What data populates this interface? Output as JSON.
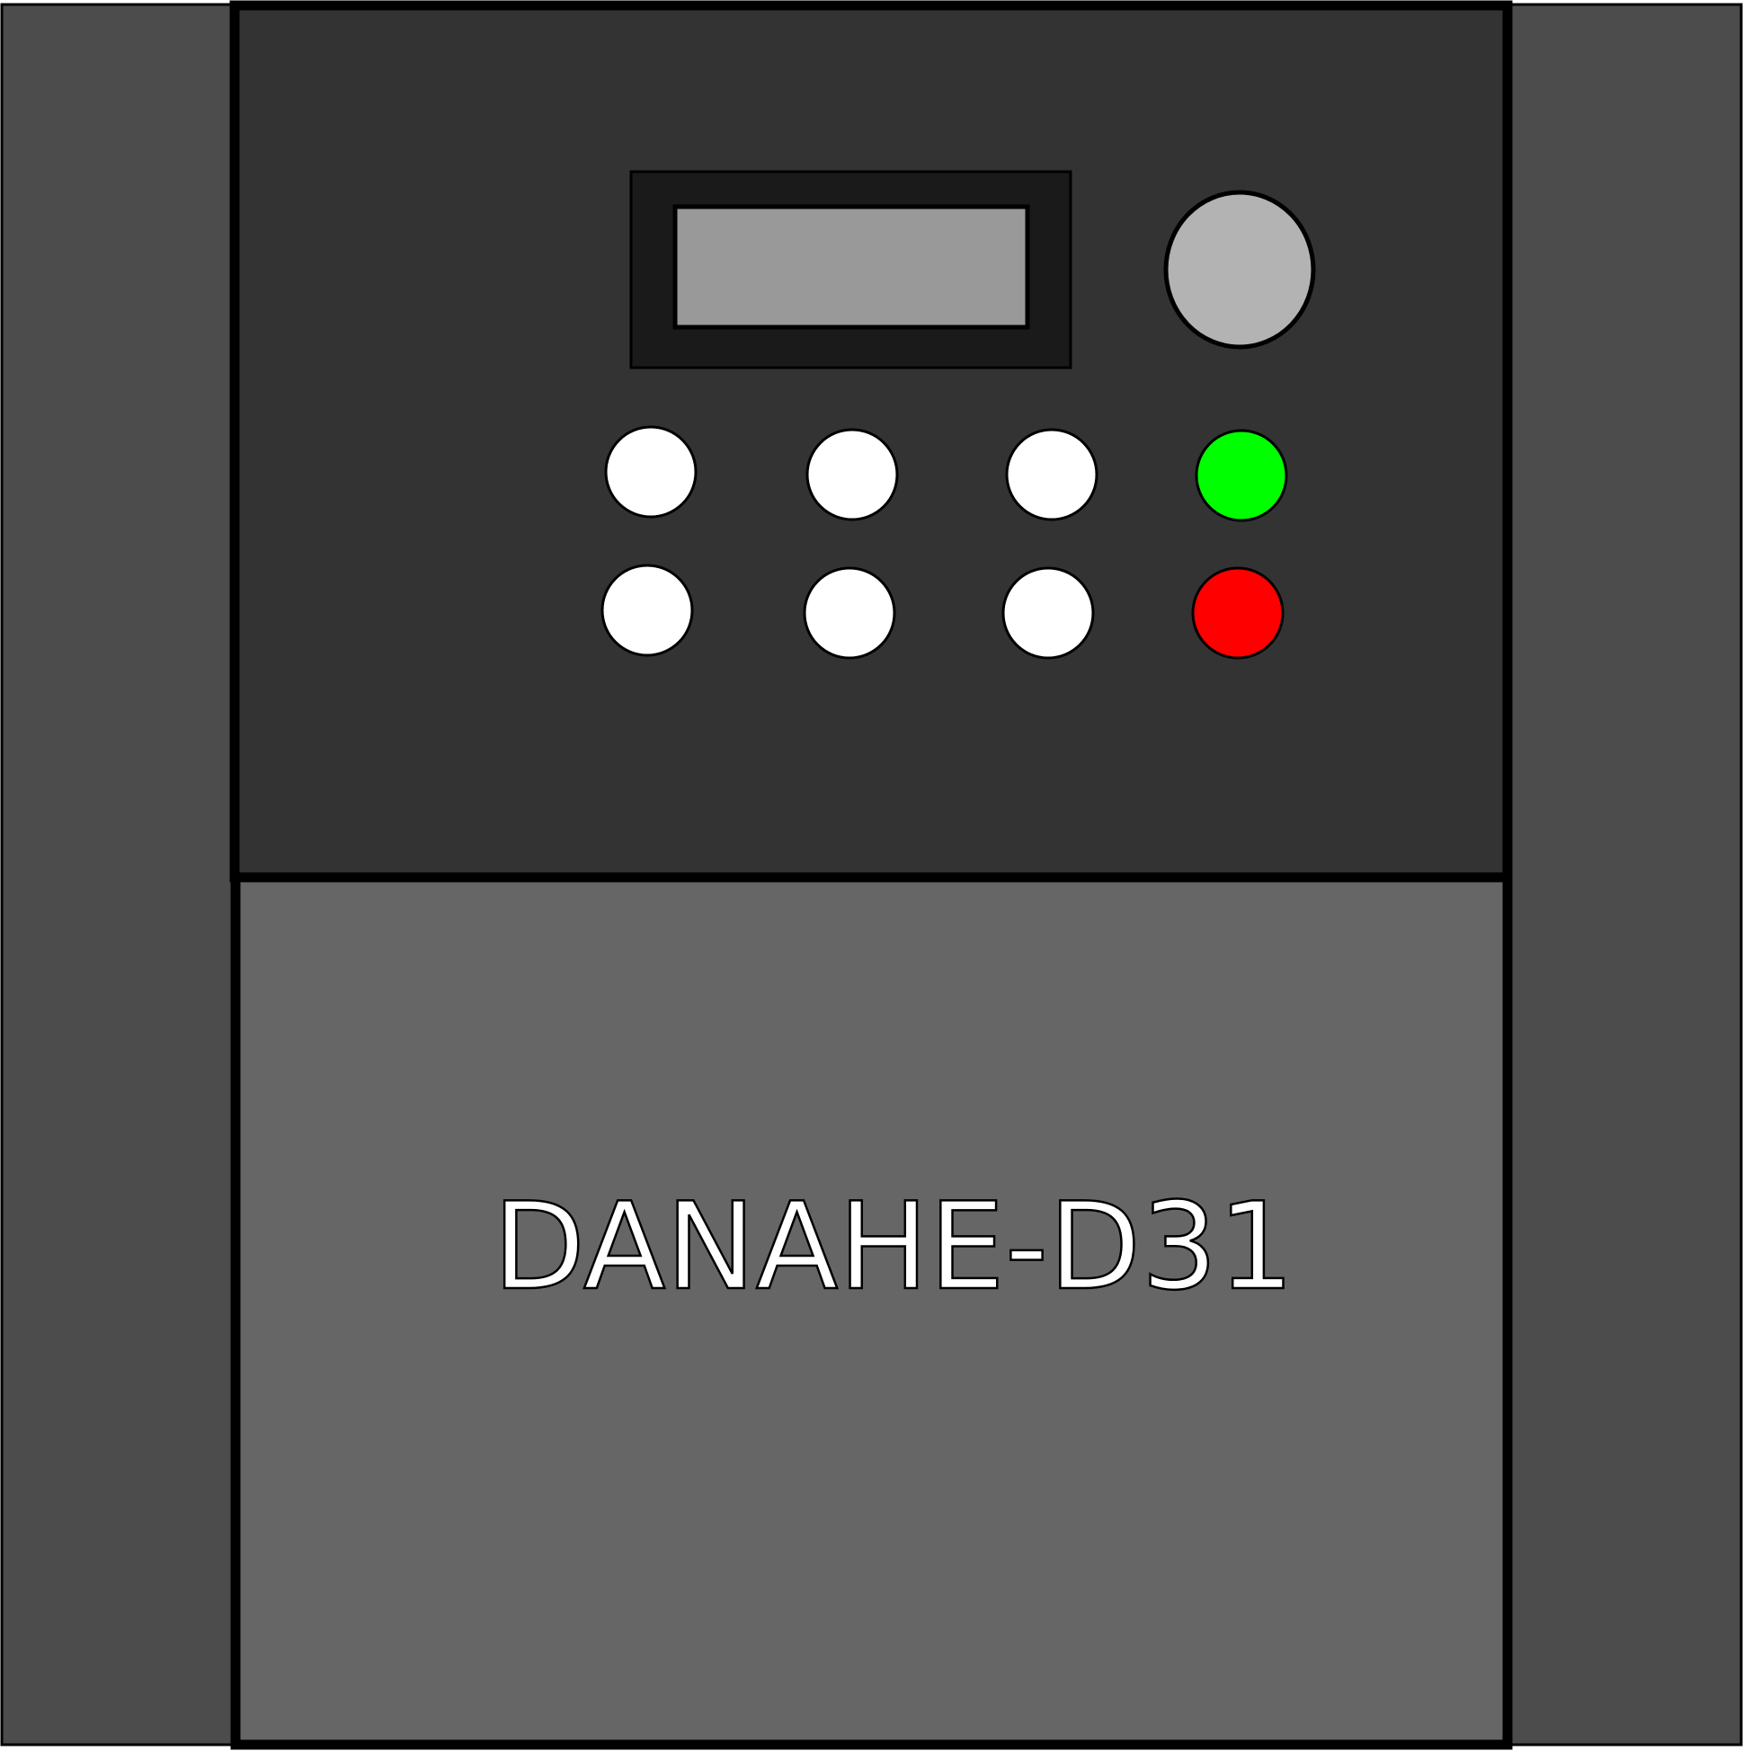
{
  "device": {
    "model_label": "DANAHE-D31"
  },
  "display": {
    "screen_text": ""
  },
  "keypad": {
    "keys": [
      "key-1",
      "key-2",
      "key-3",
      "key-4",
      "key-5",
      "key-6"
    ],
    "start_button": "start-button",
    "stop_button": "stop-button"
  },
  "colors": {
    "side_panel": "#4c4c4c",
    "upper_panel": "#333333",
    "lower_panel": "#666666",
    "display_bezel": "#1a1a1a",
    "display_screen": "#999999",
    "knob": "#b3b3b3",
    "keys": "#ffffff",
    "start": "#00ff00",
    "stop": "#ff0000"
  }
}
